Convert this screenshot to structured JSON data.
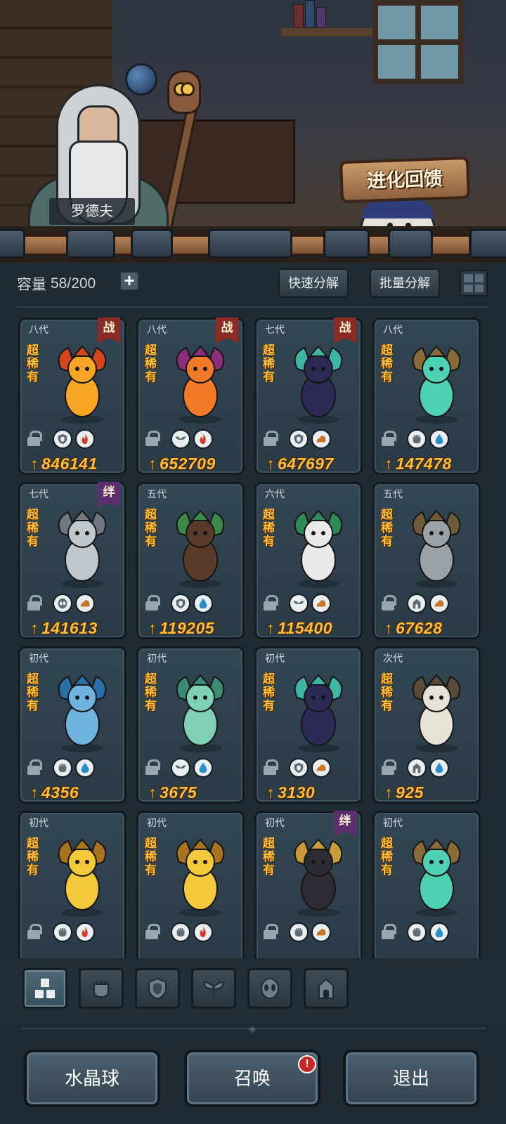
{
  "scene": {
    "npc_name": "罗德夫",
    "evolution_feedback_label": "进化回馈"
  },
  "header": {
    "capacity_label": "容量",
    "capacity_value": "58/200",
    "expand_label": "+",
    "quick_decompose_label": "快速分解",
    "batch_decompose_label": "批量分解"
  },
  "cards": [
    {
      "generation": "八代",
      "badge": "战",
      "rarity": "超稀有",
      "element1": "shield-icon",
      "element2": "fire-icon",
      "power": "846141"
    },
    {
      "generation": "八代",
      "badge": "战",
      "rarity": "超稀有",
      "element1": "leaf-icon",
      "element2": "fire-icon",
      "power": "652709"
    },
    {
      "generation": "七代",
      "badge": "战",
      "rarity": "超稀有",
      "element1": "shield-icon",
      "element2": "earth-icon",
      "power": "647697"
    },
    {
      "generation": "八代",
      "badge": "",
      "rarity": "超稀有",
      "element1": "fist-icon",
      "element2": "water-icon",
      "power": "147478"
    },
    {
      "generation": "七代",
      "badge": "绊",
      "rarity": "超稀有",
      "element1": "alien-icon",
      "element2": "earth-icon",
      "power": "141613"
    },
    {
      "generation": "五代",
      "badge": "",
      "rarity": "超稀有",
      "element1": "shield-icon",
      "element2": "water-icon",
      "power": "119205"
    },
    {
      "generation": "六代",
      "badge": "",
      "rarity": "超稀有",
      "element1": "leaf-icon",
      "element2": "earth-icon",
      "power": "115400"
    },
    {
      "generation": "五代",
      "badge": "",
      "rarity": "超稀有",
      "element1": "tower-icon",
      "element2": "earth-icon",
      "power": "67628"
    },
    {
      "generation": "初代",
      "badge": "",
      "rarity": "超稀有",
      "element1": "fist-icon",
      "element2": "water-icon",
      "power": "4356"
    },
    {
      "generation": "初代",
      "badge": "",
      "rarity": "超稀有",
      "element1": "leaf-icon",
      "element2": "water-icon",
      "power": "3675"
    },
    {
      "generation": "初代",
      "badge": "",
      "rarity": "超稀有",
      "element1": "shield-icon",
      "element2": "earth-icon",
      "power": "3130"
    },
    {
      "generation": "次代",
      "badge": "",
      "rarity": "超稀有",
      "element1": "tower-icon",
      "element2": "water-icon",
      "power": "925"
    },
    {
      "generation": "初代",
      "badge": "",
      "rarity": "超稀有",
      "element1": "fist-icon",
      "element2": "fire-icon",
      "power": ""
    },
    {
      "generation": "初代",
      "badge": "",
      "rarity": "超稀有",
      "element1": "fist-icon",
      "element2": "fire-icon",
      "power": ""
    },
    {
      "generation": "初代",
      "badge": "绊",
      "rarity": "超稀有",
      "element1": "fist-icon",
      "element2": "earth-icon",
      "power": ""
    },
    {
      "generation": "初代",
      "badge": "",
      "rarity": "超稀有",
      "element1": "fist-icon",
      "element2": "water-icon",
      "power": ""
    }
  ],
  "filter_tabs": [
    "all-icon",
    "fist-icon",
    "shield-icon",
    "leaf-icon",
    "alien-icon",
    "tower-icon"
  ],
  "bottom": {
    "crystal_ball_label": "水晶球",
    "summon_label": "召唤",
    "summon_alert": "!",
    "exit_label": "退出"
  },
  "colors": {
    "accent_gold": "#ffbf3a",
    "badge_battle": "#8a2b24",
    "badge_bond": "#5d2f6e",
    "card_bg": "#2f4350"
  }
}
